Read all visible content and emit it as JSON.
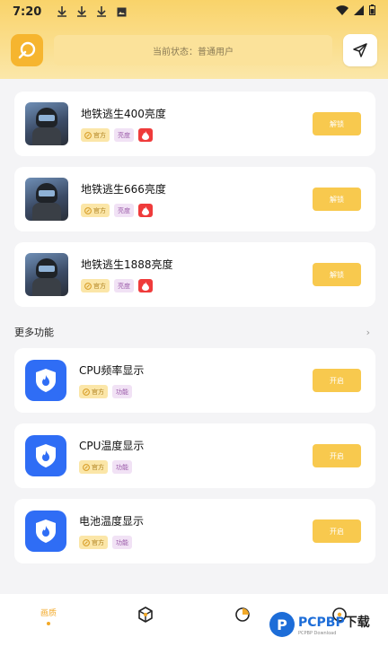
{
  "status_bar": {
    "time": "7:20"
  },
  "header": {
    "status_text": "当前状态：普通用户"
  },
  "cards_top": [
    {
      "title": "地铁逃生400亮度",
      "tag1": "官方",
      "tag2": "亮度",
      "action": "解锁"
    },
    {
      "title": "地铁逃生666亮度",
      "tag1": "官方",
      "tag2": "亮度",
      "action": "解锁"
    },
    {
      "title": "地铁逃生1888亮度",
      "tag1": "官方",
      "tag2": "亮度",
      "action": "解锁"
    }
  ],
  "section": {
    "title": "更多功能",
    "chevron": "›"
  },
  "cards_more": [
    {
      "title": "CPU频率显示",
      "tag1": "官方",
      "tag2": "功能",
      "action": "开启"
    },
    {
      "title": "CPU温度显示",
      "tag1": "官方",
      "tag2": "功能",
      "action": "开启"
    },
    {
      "title": "电池温度显示",
      "tag1": "官方",
      "tag2": "功能",
      "action": "开启"
    }
  ],
  "bottom_nav": {
    "items": [
      {
        "label": "画质"
      }
    ]
  },
  "watermark": {
    "brand": "PCPBP",
    "suffix": "下载",
    "sub": "PCPBP Download"
  },
  "colors": {
    "accent": "#f8c94e",
    "header": "#f9d36a",
    "shield": "#2f6df5",
    "hot": "#ef3b3b"
  }
}
